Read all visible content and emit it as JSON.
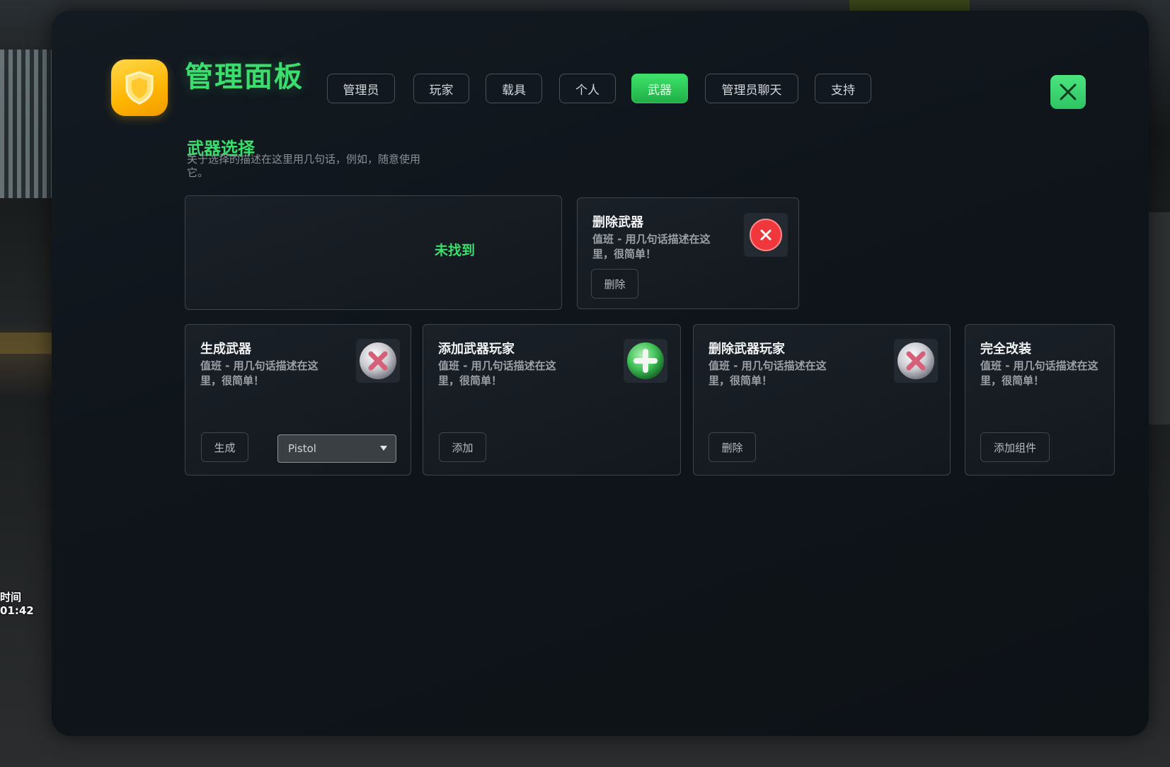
{
  "hud": {
    "time_label": "时间",
    "time_value": "01:42"
  },
  "header": {
    "title": "管理面板",
    "logo_icon": "shield-icon",
    "tabs": [
      {
        "label": "管理员",
        "active": false
      },
      {
        "label": "玩家",
        "active": false
      },
      {
        "label": "载具",
        "active": false
      },
      {
        "label": "个人",
        "active": false
      },
      {
        "label": "武器",
        "active": true
      },
      {
        "label": "管理员聊天",
        "active": false
      },
      {
        "label": "支持",
        "active": false
      }
    ],
    "close_icon": "close-icon"
  },
  "section": {
    "title": "武器选择",
    "description": "关于选择的描述在这里用几句话，例如，随意使用它。"
  },
  "weapon_list": {
    "empty_text": "未找到"
  },
  "cards": {
    "delete_weapon": {
      "title": "删除武器",
      "desc": "值班 - 用几句话描述在这里，很简单！",
      "button": "删除",
      "icon": "x-circle-icon"
    },
    "spawn_weapon": {
      "title": "生成武器",
      "desc": "值班 - 用几句话描述在这里，很简单！",
      "button": "生成",
      "icon": "x-orb-icon",
      "select_value": "Pistol"
    },
    "add_weapon_player": {
      "title": "添加武器玩家",
      "desc": "值班 - 用几句话描述在这里，很简单！",
      "button": "添加",
      "icon": "plus-orb-icon"
    },
    "remove_weapon_player": {
      "title": "删除武器玩家",
      "desc": "值班 - 用几句话描述在这里，很简单！",
      "button": "删除",
      "icon": "x-orb-icon"
    },
    "full_mod": {
      "title": "完全改装",
      "desc": "值班 - 用几句话描述在这里，很简单！",
      "button": "添加组件"
    }
  },
  "colors": {
    "accent": "#3bde6c",
    "logo": "#ffc21a",
    "danger": "#f0383c"
  }
}
